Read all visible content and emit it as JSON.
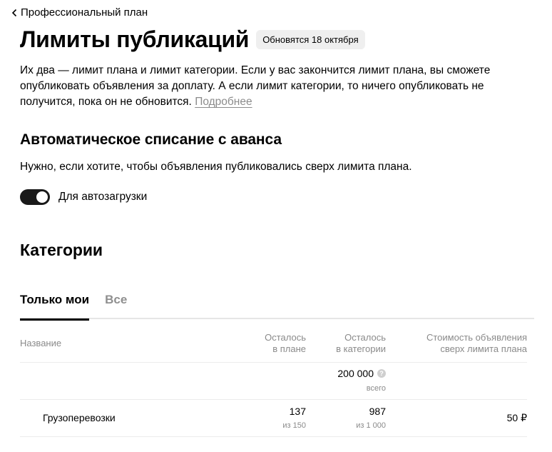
{
  "header": {
    "back_label": "Профессиональный план",
    "title": "Лимиты публикаций",
    "badge": "Обновятся 18 октября"
  },
  "intro": {
    "text": "Их два — лимит плана и лимит категории. Если у вас закончится лимит плана, вы сможете опубликовать объявления за доплату. А если лимит категории, то ничего опубликовать не получится, пока он не обновится.",
    "more_link": "Подробнее"
  },
  "auto": {
    "heading": "Автоматическое списание с аванса",
    "description": "Нужно, если хотите, чтобы объявления публиковались сверх лимита плана.",
    "toggle_label": "Для автозагрузки",
    "toggle_on": true
  },
  "categories": {
    "heading": "Категории",
    "tabs": [
      {
        "label": "Только мои",
        "active": true
      },
      {
        "label": "Все",
        "active": false
      }
    ],
    "columns": {
      "name": "Название",
      "left_plan_1": "Осталось",
      "left_plan_2": "в плане",
      "left_cat_1": "Осталось",
      "left_cat_2": "в категории",
      "cost_1": "Стоимость объявления",
      "cost_2": "сверх лимита плана"
    },
    "total": {
      "value": "200 000",
      "label": "всего"
    },
    "rows": [
      {
        "name": "Грузоперевозки",
        "left_plan": "137",
        "plan_of": "из 150",
        "left_cat": "987",
        "cat_of": "из 1 000",
        "cost": "50 ₽"
      }
    ]
  }
}
